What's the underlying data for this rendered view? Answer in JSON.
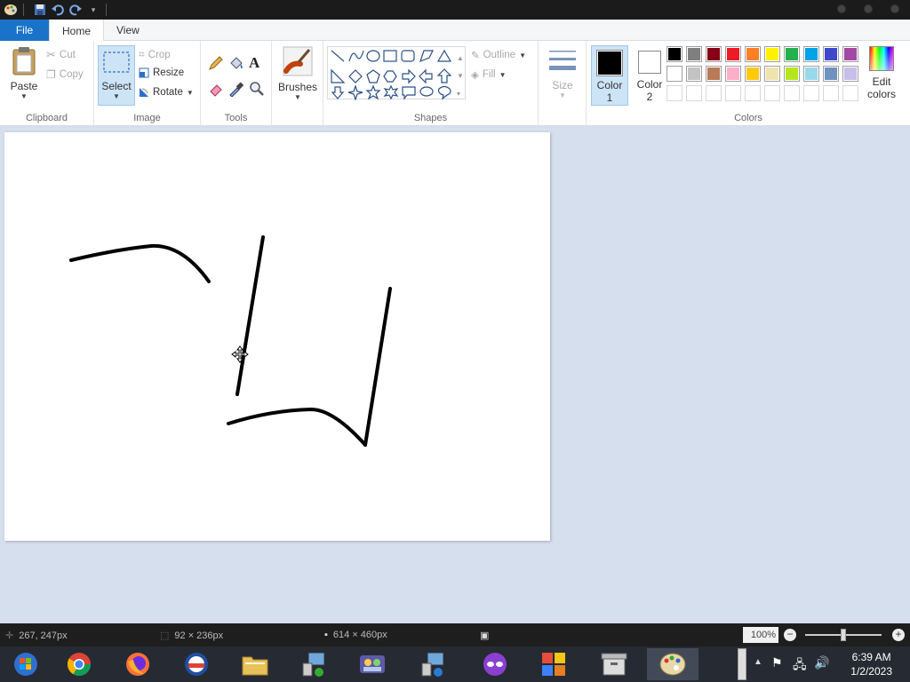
{
  "tabs": {
    "file": "File",
    "home": "Home",
    "view": "View"
  },
  "clipboard": {
    "paste": "Paste",
    "cut": "Cut",
    "copy": "Copy",
    "label": "Clipboard"
  },
  "image": {
    "select": "Select",
    "crop": "Crop",
    "resize": "Resize",
    "rotate": "Rotate",
    "label": "Image"
  },
  "tools": {
    "label": "Tools"
  },
  "brushes": {
    "label": "Brushes"
  },
  "shapes": {
    "outline": "Outline",
    "fill": "Fill",
    "label": "Shapes"
  },
  "size": {
    "label": "Size"
  },
  "colors": {
    "color1_line1": "Color",
    "color1_line2": "1",
    "color2_line1": "Color",
    "color2_line2": "2",
    "edit_line1": "Edit",
    "edit_line2": "colors",
    "label": "Colors",
    "color1": "#000000",
    "color2": "#ffffff",
    "palette_row1": [
      "#000000",
      "#7f7f7f",
      "#880015",
      "#ed1c24",
      "#ff7f27",
      "#fff200",
      "#22b14c",
      "#00a2e8",
      "#3f48cc",
      "#a349a4"
    ],
    "palette_row2": [
      "#ffffff",
      "#c3c3c3",
      "#b97a57",
      "#ffaec9",
      "#ffc90e",
      "#efe4b0",
      "#b5e61d",
      "#99d9ea",
      "#7092be",
      "#c8bfe7"
    ]
  },
  "status": {
    "cursor_pos": "267, 247px",
    "selection_size": "92 × 236px",
    "image_size": "614 × 460px",
    "zoom": "100%"
  },
  "clock": {
    "time": "6:39 AM",
    "date": "1/2/2023"
  }
}
